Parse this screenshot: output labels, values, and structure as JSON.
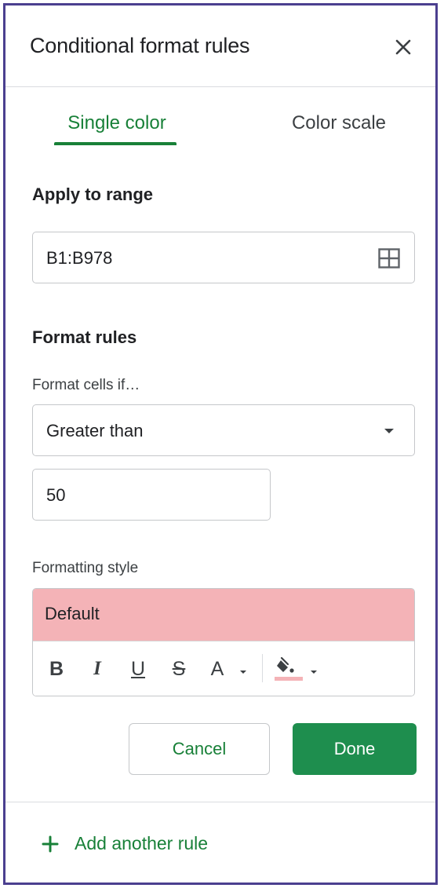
{
  "header": {
    "title": "Conditional format rules",
    "close_icon": "close-icon"
  },
  "tabs": [
    {
      "label": "Single color",
      "active": true
    },
    {
      "label": "Color scale",
      "active": false
    }
  ],
  "apply_range": {
    "label": "Apply to range",
    "value": "B1:B978",
    "icon": "grid-select-icon"
  },
  "format_rules": {
    "label": "Format rules",
    "condition_label": "Format cells if…",
    "condition_value": "Greater than",
    "threshold_value": "50"
  },
  "formatting_style": {
    "label": "Formatting style",
    "preview_text": "Default",
    "preview_color": "#f4b3b7",
    "toolbar": {
      "bold": "B",
      "italic": "I",
      "underline": "U",
      "strikethrough": "S",
      "text_color": "A",
      "fill_icon": "fill-color-icon",
      "fill_color": "#f4b3b7"
    }
  },
  "actions": {
    "cancel_label": "Cancel",
    "done_label": "Done"
  },
  "footer": {
    "add_rule_label": "Add another rule"
  },
  "colors": {
    "accent": "#188038",
    "done_bg": "#1e8e4e",
    "panel_border": "#4b3f8f"
  }
}
